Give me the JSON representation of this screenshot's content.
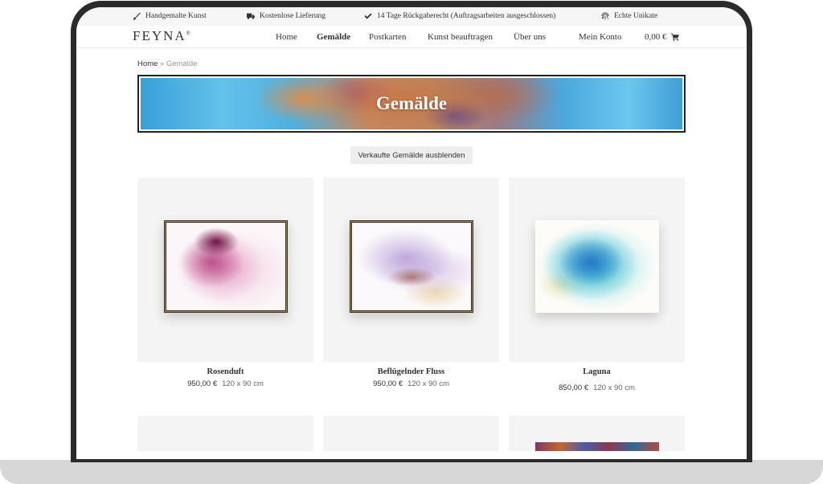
{
  "topbar": {
    "items": [
      {
        "label": "Handgemalte Kunst",
        "icon": "brush-icon"
      },
      {
        "label": "Kostenlose Lieferung",
        "icon": "truck-icon"
      },
      {
        "label": "14 Tage Rückgaberecht (Auftragsarbeiten ausgeschlossen)",
        "icon": "check-icon"
      },
      {
        "label": "Echte Unikate",
        "icon": "fingerprint-icon"
      }
    ]
  },
  "header": {
    "logo": "FEYNA",
    "logo_mark": "®",
    "nav": [
      {
        "label": "Home"
      },
      {
        "label": "Gemälde",
        "active": true
      },
      {
        "label": "Postkarten"
      },
      {
        "label": "Kunst beauftragen"
      },
      {
        "label": "Über uns"
      },
      {
        "label": "Mein Konto"
      }
    ],
    "cart_total": "0,00 €"
  },
  "breadcrumb": {
    "home": "Home",
    "separator": "»",
    "current": "Gemälde"
  },
  "banner": {
    "title": "Gemälde"
  },
  "filter_button": "Verkaufte Gemälde ausblenden",
  "products": [
    {
      "title": "Rosenduft",
      "price": "950,00 €",
      "dimensions": "120 x 90 cm"
    },
    {
      "title": "Beflügelnder Fluss",
      "price": "950,00 €",
      "dimensions": "120 x 90 cm"
    },
    {
      "title": "Laguna",
      "price": "850,00 €",
      "dimensions": "120 x 90 cm"
    }
  ]
}
